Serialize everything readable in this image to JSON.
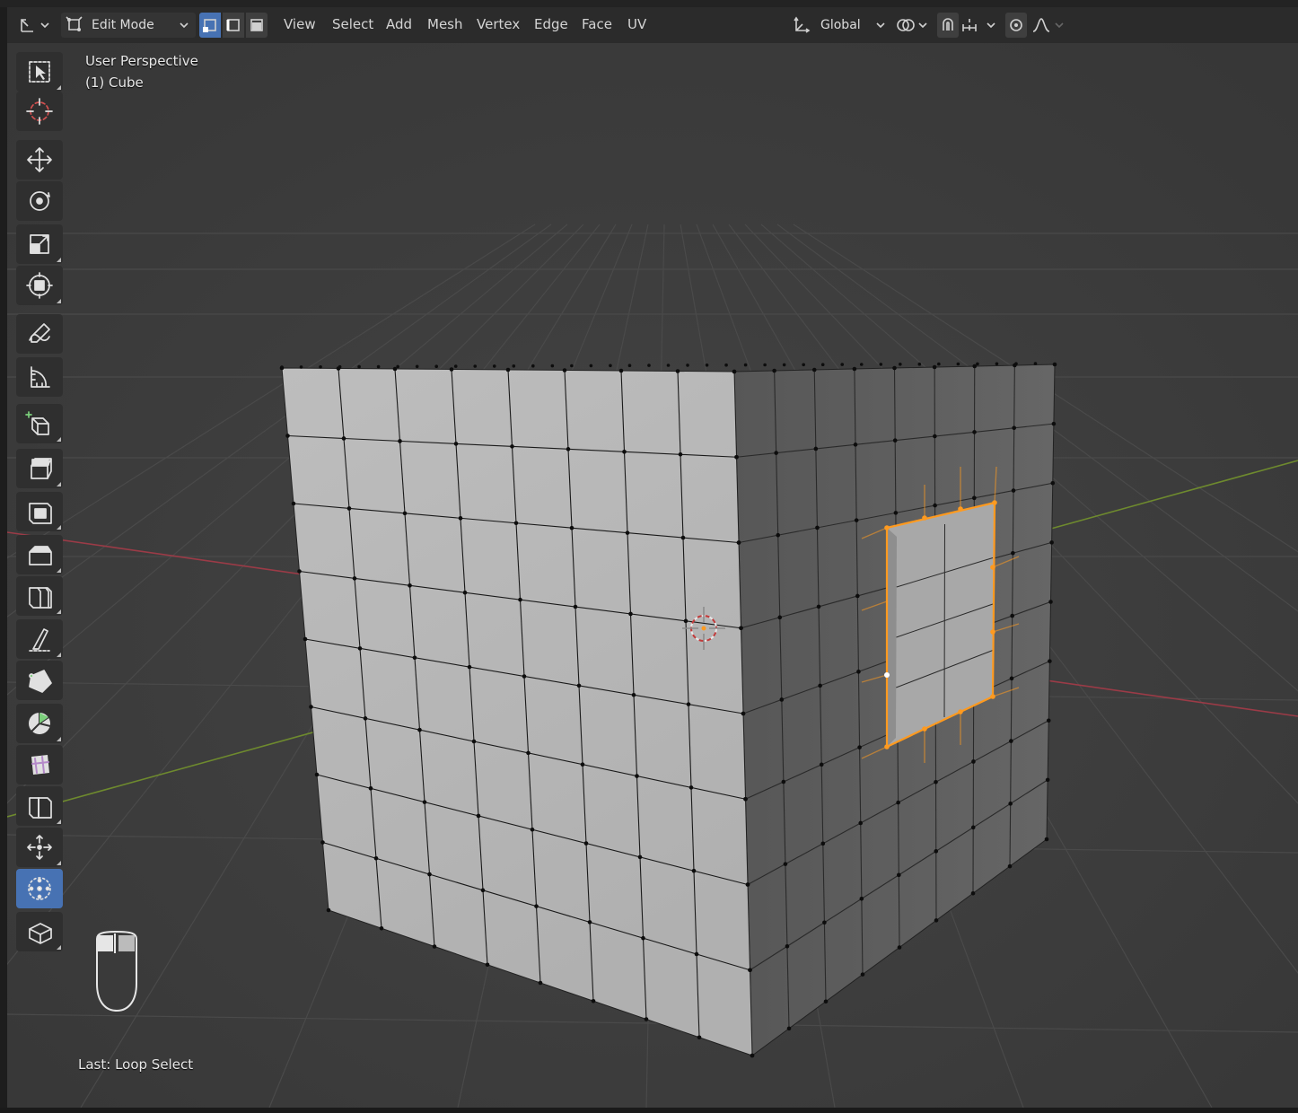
{
  "header": {
    "mode_label": "Edit Mode",
    "menus": [
      "View",
      "Select",
      "Add",
      "Mesh",
      "Vertex",
      "Edge",
      "Face",
      "UV"
    ],
    "orientation_label": "Global",
    "icons": {
      "editor_type": "editor-type-icon",
      "mode": "edit-mode-icon",
      "vertex_select": "vertex-select-icon",
      "edge_select": "edge-select-icon",
      "face_select": "face-select-icon",
      "orientation": "transform-orientation-icon",
      "pivot": "pivot-point-icon",
      "snap": "snap-icon",
      "snap_increment": "snap-increment-icon",
      "proportional": "proportional-editing-icon",
      "falloff": "proportional-falloff-icon"
    }
  },
  "overlay": {
    "view_label": "User Perspective",
    "object_label": "(1) Cube",
    "last_operation": "Last: Loop Select"
  },
  "toolbar": {
    "tools": [
      {
        "name": "select-box-tool",
        "icon": "select-box-icon",
        "active": false
      },
      {
        "name": "cursor-tool",
        "icon": "cursor-icon",
        "active": false
      },
      {
        "name": "move-tool",
        "icon": "move-icon",
        "active": false
      },
      {
        "name": "rotate-tool",
        "icon": "rotate-icon",
        "active": false
      },
      {
        "name": "scale-tool",
        "icon": "scale-icon",
        "active": false
      },
      {
        "name": "transform-tool",
        "icon": "transform-icon",
        "active": false
      },
      {
        "name": "annotate-tool",
        "icon": "annotate-icon",
        "active": false
      },
      {
        "name": "measure-tool",
        "icon": "measure-icon",
        "active": false
      },
      {
        "name": "add-cube-tool",
        "icon": "add-cube-icon",
        "active": false
      },
      {
        "name": "extrude-region-tool",
        "icon": "extrude-icon",
        "active": false
      },
      {
        "name": "inset-faces-tool",
        "icon": "inset-icon",
        "active": false
      },
      {
        "name": "bevel-tool",
        "icon": "bevel-icon",
        "active": false
      },
      {
        "name": "loop-cut-tool",
        "icon": "loop-cut-icon",
        "active": false
      },
      {
        "name": "knife-tool",
        "icon": "knife-icon",
        "active": false
      },
      {
        "name": "poly-build-tool",
        "icon": "poly-build-icon",
        "active": false
      },
      {
        "name": "spin-tool",
        "icon": "spin-icon",
        "active": false
      },
      {
        "name": "smooth-tool",
        "icon": "smooth-icon",
        "active": false
      },
      {
        "name": "edge-slide-tool",
        "icon": "edge-slide-icon",
        "active": false
      },
      {
        "name": "shrink-fatten-tool",
        "icon": "shrink-fatten-icon",
        "active": false
      },
      {
        "name": "to-sphere-tool",
        "icon": "to-sphere-icon",
        "active": true
      },
      {
        "name": "rip-region-tool",
        "icon": "rip-icon",
        "active": false
      }
    ]
  },
  "colors": {
    "viewport_bg": "#3c3c3c",
    "header_bg": "#2b2b2b",
    "tool_active": "#4772b3",
    "selection": "#ff9a1f",
    "x_axis": "#9b3b47",
    "y_axis": "#6e8a2e",
    "mesh_front": "#b8b8b8",
    "mesh_side": "#5e5e5e"
  }
}
